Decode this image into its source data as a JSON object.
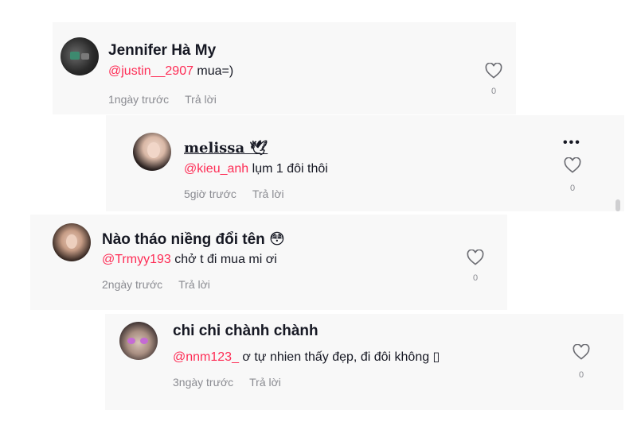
{
  "comments": [
    {
      "username": "Jennifer Hà My",
      "mention": "@justin__2907",
      "text": " mua=)",
      "time": "1ngày trước",
      "reply": "Trả lời",
      "likes": "0"
    },
    {
      "username": "𝐦𝐞𝐥𝐢𝐬𝐬𝐚 🕊",
      "mention": "@kieu_anh",
      "text": " lụm 1 đôi thôi",
      "time": "5giờ trước",
      "reply": "Trả lời",
      "likes": "0",
      "more": "•••"
    },
    {
      "username": "Nào tháo niềng đổi tên 😳",
      "mention": "@Trmyy193",
      "text": " chở t đi mua mi ơi",
      "time": "2ngày trước",
      "reply": "Trả lời",
      "likes": "0"
    },
    {
      "username": "chi chi chành chành",
      "mention": "@nnm123_",
      "text": " ơ tự nhien thấy đẹp, đi đôi không ▯",
      "time": "3ngày trước",
      "reply": "Trả lời",
      "likes": "0"
    }
  ],
  "icons": {
    "like": "heart-outline-icon",
    "more": "more-horizontal-icon"
  },
  "colors": {
    "mention": "#fe2c55",
    "meta": "#8a8b91",
    "card": "#f8f8f8"
  }
}
